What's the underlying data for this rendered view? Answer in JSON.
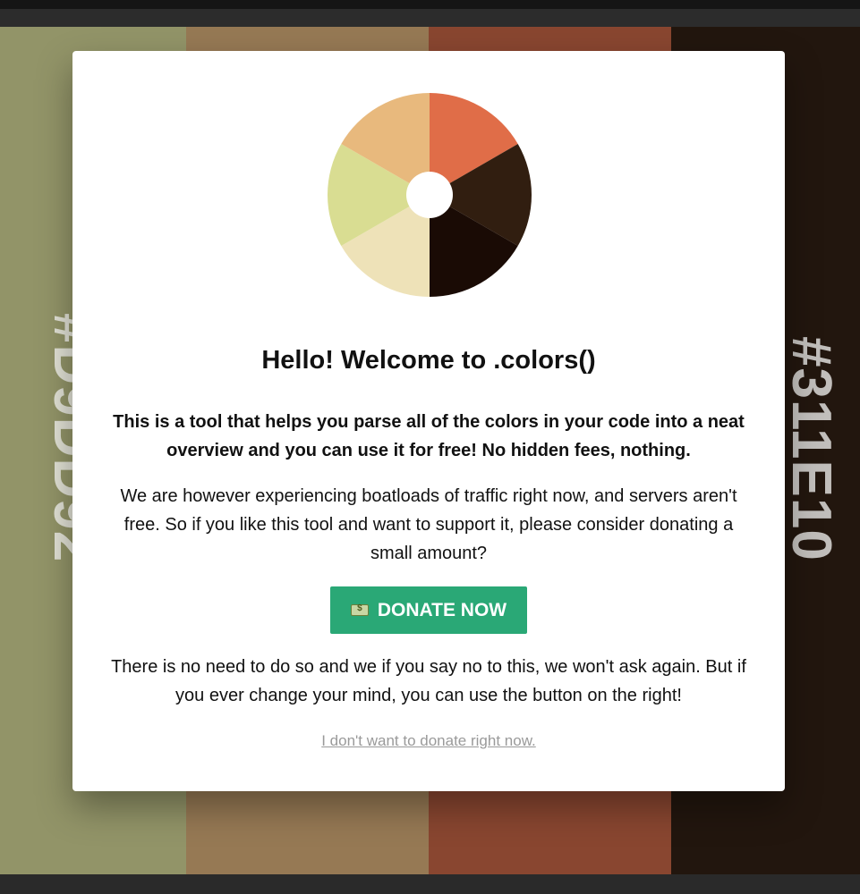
{
  "background": {
    "stripes": [
      {
        "color": "#B3B57F"
      },
      {
        "color": "#B89467"
      },
      {
        "color": "#A8563B"
      },
      {
        "color": "#2A1C12"
      }
    ],
    "left_hex": "#D9DD92",
    "right_hex": "#311E10"
  },
  "modal": {
    "wheel_colors": [
      "#E06D48",
      "#311E10",
      "#1A0B05",
      "#EEE2B8",
      "#D9DD92",
      "#E8B97D"
    ],
    "title": "Hello! Welcome to .colors()",
    "lead": "This is a tool that helps you parse all of the colors in your code into a neat overview and you can use it for free! No hidden fees, nothing.",
    "body": "We are however experiencing boatloads of traffic right now, and servers aren't free. So if you like this tool and want to support it, please consider donating a small amount?",
    "donate_label": "DONATE NOW",
    "donate_icon": "money-icon",
    "donate_color": "#2AA876",
    "footer": "There is no need to do so and we if you say no to this, we won't ask again. But if you ever change your mind, you can use the button on the right!",
    "decline_label": "I don't want to donate right now."
  }
}
